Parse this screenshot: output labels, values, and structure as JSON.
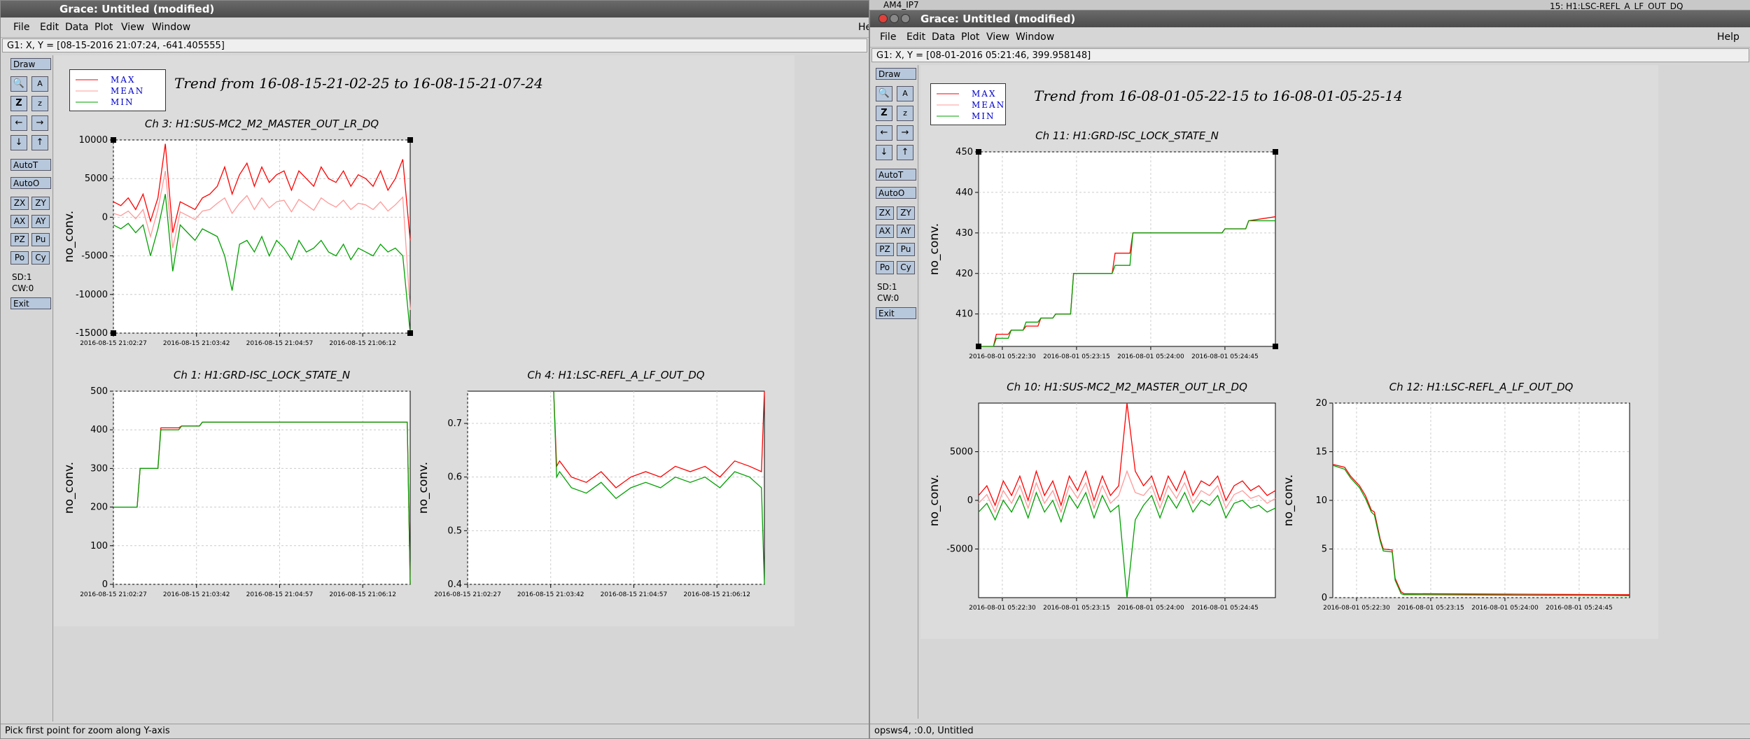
{
  "desktop": {
    "bg_labels": [
      "AM4_IP7",
      "15: H1:LSC-REFL_A_LF_OUT_DQ"
    ]
  },
  "left_window": {
    "title": "Grace: Untitled (modified)",
    "menu": [
      "File",
      "Edit",
      "Data",
      "Plot",
      "View",
      "Window"
    ],
    "menu_help_partial": "He",
    "locator": "G1: X, Y = [08-15-2016 21:07:24, -641.405555]",
    "toolbox": {
      "draw": "Draw",
      "autot": "AutoT",
      "autoo": "AutoO",
      "zoom_buttons": [
        "ZX",
        "ZY",
        "AX",
        "AY",
        "PZ",
        "Pu",
        "Po",
        "Cy"
      ],
      "sd": "SD:1",
      "cw": "CW:0",
      "exit": "Exit"
    },
    "legend": [
      "MAX",
      "MEAN",
      "MIN"
    ],
    "trend_title": "Trend from 16-08-15-21-02-25 to 16-08-15-21-07-24",
    "status": "Pick first point for zoom along Y-axis"
  },
  "right_window": {
    "title": "Grace: Untitled (modified)",
    "menu": [
      "File",
      "Edit",
      "Data",
      "Plot",
      "View",
      "Window"
    ],
    "help": "Help",
    "locator": "G1: X, Y = [08-01-2016 05:21:46, 399.958148]",
    "toolbox": {
      "draw": "Draw",
      "autot": "AutoT",
      "autoo": "AutoO",
      "zoom_buttons": [
        "ZX",
        "ZY",
        "AX",
        "AY",
        "PZ",
        "Pu",
        "Po",
        "Cy"
      ],
      "sd": "SD:1",
      "cw": "CW:0",
      "exit": "Exit"
    },
    "legend": [
      "MAX",
      "MEAN",
      "MIN"
    ],
    "trend_title": "Trend from 16-08-01-05-22-15 to 16-08-01-05-25-14",
    "status": "opsws4, :0.0, Untitled"
  },
  "colors": {
    "max": "#ff0000",
    "mean": "#ff9999",
    "min": "#00a000",
    "legend_text": "#0000cc"
  },
  "chart_data": [
    {
      "id": "l1",
      "type": "line",
      "title": "Ch 3: H1:SUS-MC2_M2_MASTER_OUT_LR_DQ",
      "ylabel": "no_conv.",
      "ylim": [
        -15000,
        10000
      ],
      "yticks": [
        10000,
        5000,
        0,
        -5000,
        -10000,
        -15000
      ],
      "ytick_labels": [
        "10000",
        "5000",
        "0",
        "-5000",
        "-10000",
        "-15000"
      ],
      "xticks": [
        "2016-08-15 21:02:27",
        "2016-08-15 21:03:42",
        "2016-08-15 21:04:57",
        "2016-08-15 21:06:12"
      ],
      "x_tick_positions": [
        0,
        0.28,
        0.56,
        0.84
      ],
      "series": [
        {
          "name": "MAX",
          "values": [
            2000,
            1500,
            2500,
            1000,
            3000,
            -500,
            2500,
            9500,
            -2000,
            2000,
            1500,
            1000,
            2500,
            3000,
            4000,
            6500,
            3000,
            5500,
            7000,
            4000,
            6500,
            4500,
            5500,
            6000,
            3500,
            6000,
            5000,
            4000,
            6500,
            5000,
            4500,
            6000,
            4000,
            5500,
            5000,
            4000,
            6000,
            3500,
            5000,
            7500,
            -3000
          ]
        },
        {
          "name": "MEAN",
          "values": [
            500,
            200,
            800,
            -200,
            1000,
            -2500,
            1000,
            6000,
            -4000,
            700,
            200,
            -300,
            800,
            1000,
            1800,
            2500,
            500,
            1800,
            2800,
            1000,
            2500,
            1200,
            2000,
            2200,
            700,
            2300,
            1600,
            900,
            2500,
            1800,
            1300,
            2200,
            1000,
            1800,
            1600,
            1000,
            2000,
            800,
            1600,
            2600,
            -12000
          ]
        },
        {
          "name": "MIN",
          "values": [
            -1000,
            -1500,
            -800,
            -2000,
            -1000,
            -5000,
            -1500,
            3000,
            -7000,
            -1000,
            -2000,
            -3000,
            -1500,
            -2000,
            -2500,
            -5000,
            -9500,
            -3500,
            -3000,
            -4500,
            -2500,
            -5000,
            -3000,
            -4000,
            -5500,
            -3000,
            -4500,
            -4000,
            -3000,
            -4500,
            -5000,
            -3500,
            -5500,
            -4000,
            -4500,
            -5000,
            -3500,
            -4500,
            -4000,
            -5000,
            -15000
          ]
        }
      ]
    },
    {
      "id": "l2",
      "type": "line",
      "title": "Ch 1: H1:GRD-ISC_LOCK_STATE_N",
      "ylabel": "no_conv.",
      "ylim": [
        0,
        500
      ],
      "yticks": [
        500,
        400,
        300,
        200,
        100,
        0
      ],
      "ytick_labels": [
        "500",
        "400",
        "300",
        "200",
        "100",
        "0"
      ],
      "xticks": [
        "2016-08-15 21:02:27",
        "2016-08-15 21:03:42",
        "2016-08-15 21:04:57",
        "2016-08-15 21:06:12"
      ],
      "x_tick_positions": [
        0,
        0.28,
        0.56,
        0.84
      ],
      "series": [
        {
          "name": "MAX",
          "x": [
            0,
            0.08,
            0.09,
            0.15,
            0.16,
            0.22,
            0.23,
            0.29,
            0.3,
            0.99,
            1
          ],
          "values": [
            200,
            200,
            300,
            300,
            405,
            405,
            410,
            410,
            420,
            420,
            0
          ]
        },
        {
          "name": "MIN",
          "x": [
            0,
            0.08,
            0.09,
            0.15,
            0.16,
            0.22,
            0.23,
            0.29,
            0.3,
            0.99,
            1
          ],
          "values": [
            200,
            200,
            300,
            300,
            400,
            400,
            410,
            410,
            420,
            420,
            0
          ]
        }
      ]
    },
    {
      "id": "l3",
      "type": "line",
      "title": "Ch 4: H1:LSC-REFL_A_LF_OUT_DQ",
      "ylabel": "no_conv.",
      "ylim": [
        0.4,
        0.76
      ],
      "yticks": [
        0.7,
        0.6,
        0.5,
        0.4
      ],
      "ytick_labels": [
        "0.7",
        "0.6",
        "0.5",
        "0.4"
      ],
      "xticks": [
        "2016-08-15 21:02:27",
        "2016-08-15 21:03:42",
        "2016-08-15 21:04:57",
        "2016-08-15 21:06:12"
      ],
      "x_tick_positions": [
        0,
        0.28,
        0.56,
        0.84
      ],
      "series": [
        {
          "name": "MAX",
          "x": [
            0.29,
            0.3,
            0.31,
            0.35,
            0.4,
            0.45,
            0.5,
            0.55,
            0.6,
            0.65,
            0.7,
            0.75,
            0.8,
            0.85,
            0.9,
            0.95,
            0.99,
            1
          ],
          "values": [
            0.76,
            0.62,
            0.63,
            0.6,
            0.59,
            0.61,
            0.58,
            0.6,
            0.61,
            0.6,
            0.62,
            0.61,
            0.62,
            0.6,
            0.63,
            0.62,
            0.61,
            0.76
          ]
        },
        {
          "name": "MIN",
          "x": [
            0.29,
            0.3,
            0.31,
            0.35,
            0.4,
            0.45,
            0.5,
            0.55,
            0.6,
            0.65,
            0.7,
            0.75,
            0.8,
            0.85,
            0.9,
            0.95,
            0.99,
            1
          ],
          "values": [
            0.76,
            0.6,
            0.61,
            0.58,
            0.57,
            0.59,
            0.56,
            0.58,
            0.59,
            0.58,
            0.6,
            0.59,
            0.6,
            0.58,
            0.61,
            0.6,
            0.58,
            0.4
          ]
        }
      ]
    },
    {
      "id": "r1",
      "type": "line",
      "title": "Ch 11: H1:GRD-ISC_LOCK_STATE_N",
      "ylabel": "no_conv.",
      "ylim": [
        402,
        450
      ],
      "yticks": [
        450,
        440,
        430,
        420,
        410
      ],
      "ytick_labels": [
        "450",
        "440",
        "430",
        "420",
        "410"
      ],
      "xticks": [
        "2016-08-01 05:22:30",
        "2016-08-01 05:23:15",
        "2016-08-01 05:24:00",
        "2016-08-01 05:24:45"
      ],
      "x_tick_positions": [
        0.08,
        0.33,
        0.58,
        0.83
      ],
      "series": [
        {
          "name": "MAX",
          "x": [
            0,
            0.05,
            0.06,
            0.1,
            0.11,
            0.15,
            0.16,
            0.2,
            0.21,
            0.25,
            0.26,
            0.31,
            0.32,
            0.45,
            0.46,
            0.51,
            0.52,
            0.82,
            0.83,
            0.9,
            0.91,
            1
          ],
          "values": [
            402,
            402,
            405,
            405,
            406,
            406,
            407,
            407,
            409,
            409,
            410,
            410,
            420,
            420,
            425,
            425,
            430,
            430,
            431,
            431,
            433,
            434
          ]
        },
        {
          "name": "MIN",
          "x": [
            0,
            0.05,
            0.06,
            0.1,
            0.11,
            0.15,
            0.16,
            0.2,
            0.21,
            0.25,
            0.26,
            0.31,
            0.32,
            0.45,
            0.46,
            0.51,
            0.52,
            0.82,
            0.83,
            0.9,
            0.91,
            1
          ],
          "values": [
            402,
            402,
            404,
            404,
            406,
            406,
            408,
            408,
            409,
            409,
            410,
            410,
            420,
            420,
            422,
            422,
            430,
            430,
            431,
            431,
            433,
            433
          ]
        }
      ]
    },
    {
      "id": "r2",
      "type": "line",
      "title": "Ch 10: H1:SUS-MC2_M2_MASTER_OUT_LR_DQ",
      "ylabel": "no_conv.",
      "ylim": [
        -10000,
        10000
      ],
      "yticks": [
        5000,
        0,
        -5000
      ],
      "ytick_labels": [
        "5000",
        "0",
        "-5000"
      ],
      "xticks": [
        "2016-08-01 05:22:30",
        "2016-08-01 05:23:15",
        "2016-08-01 05:24:00",
        "2016-08-01 05:24:45"
      ],
      "x_tick_positions": [
        0.08,
        0.33,
        0.58,
        0.83
      ],
      "series": [
        {
          "name": "MAX",
          "values": [
            500,
            1500,
            -500,
            2000,
            500,
            2500,
            0,
            3000,
            500,
            2000,
            -500,
            2500,
            1000,
            3000,
            0,
            2500,
            500,
            1500,
            10000,
            3000,
            1500,
            2500,
            0,
            2500,
            1000,
            3000,
            500,
            2000,
            1500,
            2500,
            0,
            1500,
            2000,
            1000,
            1500,
            500,
            1000
          ]
        },
        {
          "name": "MEAN",
          "values": [
            -300,
            600,
            -1200,
            1000,
            -300,
            1500,
            -800,
            1800,
            -300,
            1000,
            -1200,
            1500,
            200,
            1800,
            -800,
            1500,
            -300,
            500,
            3000,
            800,
            500,
            1500,
            -800,
            1500,
            200,
            1800,
            -300,
            1000,
            500,
            1500,
            -800,
            600,
            1000,
            200,
            500,
            -300,
            200
          ]
        },
        {
          "name": "MIN",
          "values": [
            -1200,
            -300,
            -2000,
            0,
            -1200,
            500,
            -1800,
            800,
            -1200,
            0,
            -2200,
            500,
            -800,
            800,
            -1800,
            500,
            -1200,
            -500,
            -10000,
            -2000,
            -500,
            500,
            -1800,
            500,
            -800,
            800,
            -1200,
            0,
            -500,
            500,
            -1800,
            -300,
            0,
            -800,
            -500,
            -1200,
            -800
          ]
        }
      ]
    },
    {
      "id": "r3",
      "type": "line",
      "title": "Ch 12: H1:LSC-REFL_A_LF_OUT_DQ",
      "ylabel": "no_conv.",
      "ylim": [
        0,
        20
      ],
      "yticks": [
        20,
        15,
        10,
        5,
        0
      ],
      "ytick_labels": [
        "20",
        "15",
        "10",
        "5",
        "0"
      ],
      "xticks": [
        "2016-08-01 05:22:30",
        "2016-08-01 05:23:15",
        "2016-08-01 05:24:00",
        "2016-08-01 05:24:45"
      ],
      "x_tick_positions": [
        0.08,
        0.33,
        0.58,
        0.83
      ],
      "series": [
        {
          "name": "MAX",
          "x": [
            0,
            0.04,
            0.06,
            0.09,
            0.11,
            0.13,
            0.14,
            0.16,
            0.17,
            0.2,
            0.21,
            0.23,
            0.24,
            0.27,
            1
          ],
          "values": [
            13.7,
            13.4,
            12.5,
            11.5,
            10.5,
            9,
            8.8,
            6,
            5,
            4.9,
            2,
            0.6,
            0.4,
            0.4,
            0.3
          ]
        },
        {
          "name": "MIN",
          "x": [
            0,
            0.04,
            0.06,
            0.09,
            0.11,
            0.13,
            0.14,
            0.16,
            0.17,
            0.2,
            0.21,
            0.23,
            0.24,
            0.27,
            1
          ],
          "values": [
            13.6,
            13.2,
            12.3,
            11.3,
            10.2,
            8.8,
            8.5,
            5.8,
            4.8,
            4.7,
            1.8,
            0.4,
            0.3,
            0.3,
            0.2
          ]
        }
      ]
    }
  ]
}
